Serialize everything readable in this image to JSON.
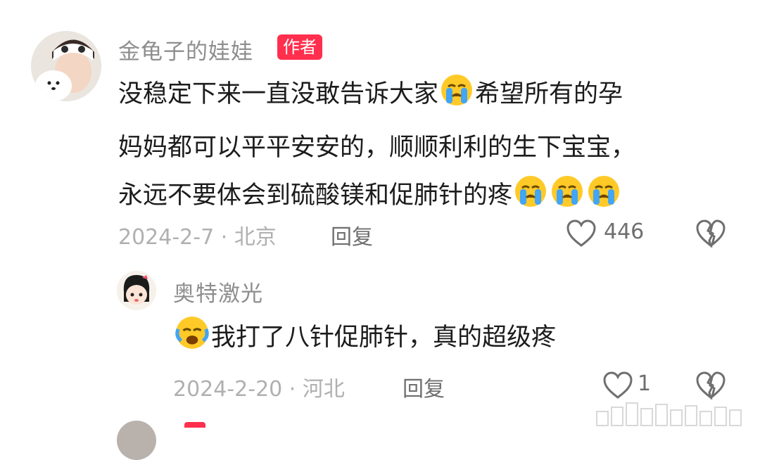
{
  "comment": {
    "author": "金龟子的娃娃",
    "badge": "作者",
    "lines": [
      {
        "before": "没稳定下来一直没敢告诉大家",
        "after": "希望所有的孕"
      },
      {
        "text": "妈妈都可以平平安安的，顺顺利利的生下宝宝，"
      },
      {
        "before": "永远不要体会到硫酸镁和促肺针的疼"
      }
    ],
    "date_location": "2024-2-7 · 北京",
    "reply_label": "回复",
    "likes": "446"
  },
  "reply": {
    "author": "奥特激光",
    "text": "我打了八针促肺针，真的超级疼",
    "date_location": "2024-2-20 · 河北",
    "reply_label": "回复",
    "likes": "1"
  },
  "icons": {
    "like": "heart-outline-icon",
    "dislike": "broken-heart-icon",
    "emoji": "crying-face-emoji",
    "author_badge_color": "#ff2f4d"
  }
}
